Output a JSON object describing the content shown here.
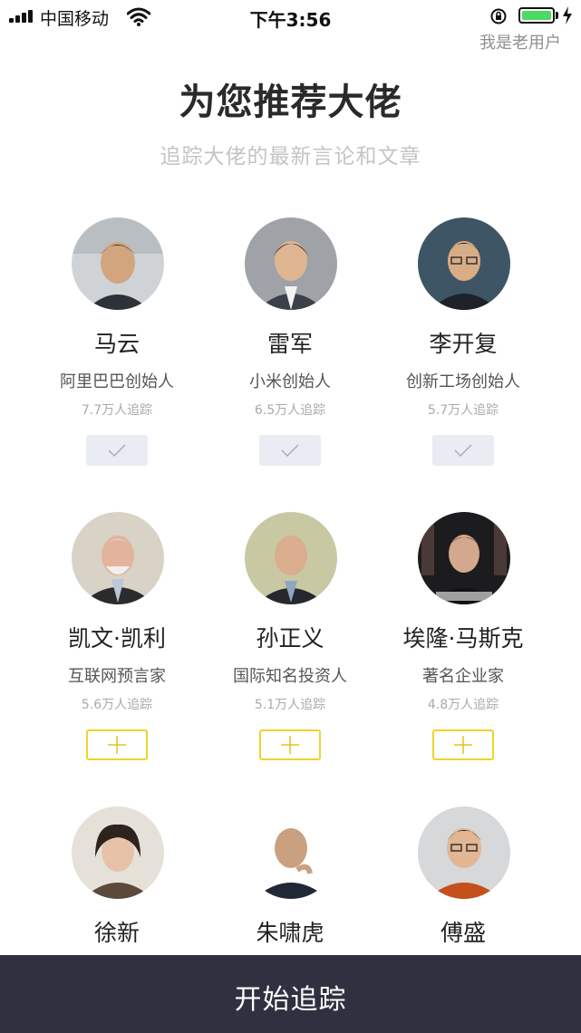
{
  "status_bar": {
    "carrier": "中国移动",
    "time": "下午3:56"
  },
  "header": {
    "old_user_link": "我是老用户",
    "title": "为您推荐大佬",
    "subtitle": "追踪大佬的最新言论和文章"
  },
  "people": [
    {
      "name": "马云",
      "title": "阿里巴巴创始人",
      "followers": "7.7万人追踪",
      "followed": true
    },
    {
      "name": "雷军",
      "title": "小米创始人",
      "followers": "6.5万人追踪",
      "followed": true
    },
    {
      "name": "李开复",
      "title": "创新工场创始人",
      "followers": "5.7万人追踪",
      "followed": true
    },
    {
      "name": "凯文·凯利",
      "title": "互联网预言家",
      "followers": "5.6万人追踪",
      "followed": false
    },
    {
      "name": "孙正义",
      "title": "国际知名投资人",
      "followers": "5.1万人追踪",
      "followed": false
    },
    {
      "name": "埃隆·马斯克",
      "title": "著名企业家",
      "followers": "4.8万人追踪",
      "followed": false
    },
    {
      "name": "徐新"
    },
    {
      "name": "朱啸虎"
    },
    {
      "name": "傅盛"
    }
  ],
  "bottom": {
    "start_button": "开始追踪"
  },
  "colors": {
    "accent_yellow": "#f0d32a",
    "bottom_bar": "#2f3140",
    "followed_button": "#e9ecf3",
    "battery": "#4cd964"
  },
  "icons": {
    "followed": "check-icon",
    "not_followed": "plus-icon"
  }
}
